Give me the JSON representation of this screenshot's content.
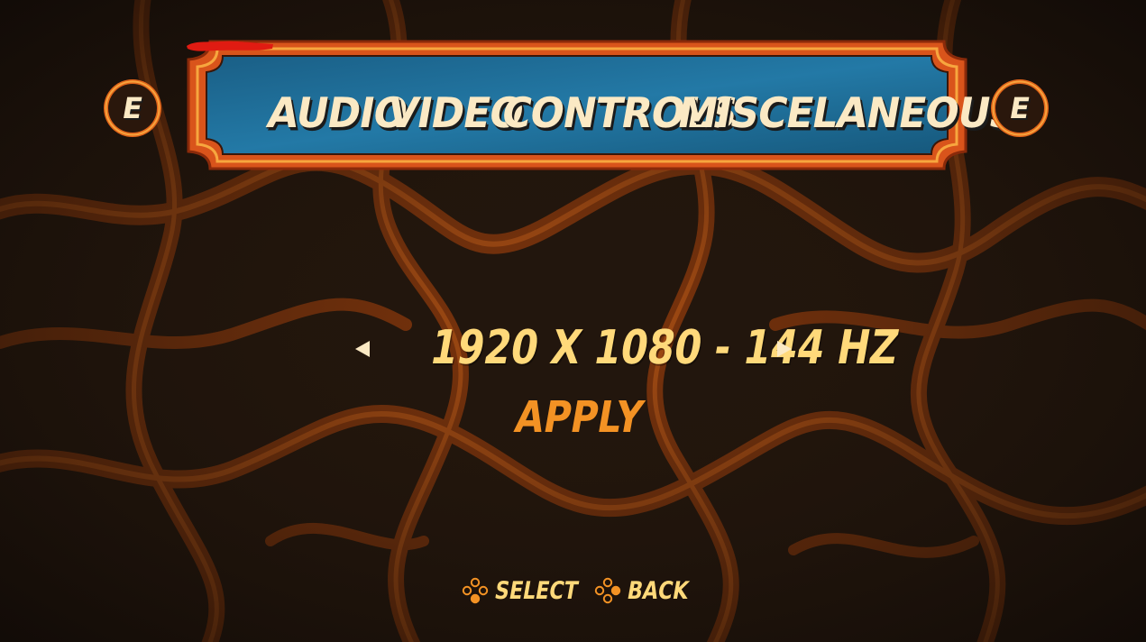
{
  "menu": {
    "tabs": [
      {
        "label": "AUDIO"
      },
      {
        "label": "VIDEO"
      },
      {
        "label": "CONTROLS"
      },
      {
        "label": "MISCELANEOUS"
      }
    ],
    "active_tab": "VIDEO",
    "bumper_left": "E",
    "bumper_right": "E"
  },
  "video": {
    "resolution": "1920 X 1080 - 144 HZ",
    "apply_label": "APPLY"
  },
  "footer": {
    "select_label": "SELECT",
    "back_label": "BACK",
    "select_icon": "dpad-buttons-icon",
    "back_icon": "dpad-buttons-icon"
  },
  "colors": {
    "background": "#1c120b",
    "lava": "#a9470f",
    "banner_blue": "#1f6d95",
    "frame_orange": "#ef7a1e",
    "tab_text": "#fbe9c4",
    "active_underline": "#e01b12",
    "value_text": "#ffd97a",
    "apply_text": "#f39224"
  }
}
